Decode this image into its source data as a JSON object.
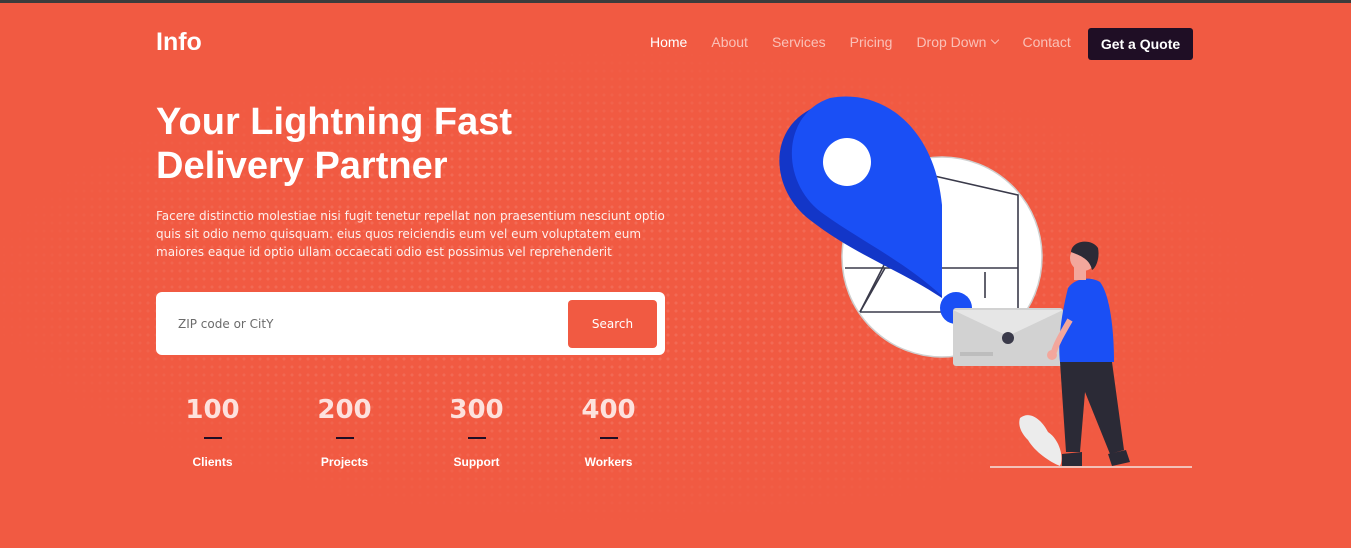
{
  "header": {
    "logo": "Info",
    "nav": [
      {
        "label": "Home",
        "active": true
      },
      {
        "label": "About",
        "active": false
      },
      {
        "label": "Services",
        "active": false
      },
      {
        "label": "Pricing",
        "active": false
      },
      {
        "label": "Drop Down",
        "active": false,
        "has_dropdown": true
      },
      {
        "label": "Contact",
        "active": false
      }
    ],
    "cta_label": "Get a Quote"
  },
  "hero": {
    "title_line1": "Your Lightning Fast",
    "title_line2": "Delivery Partner",
    "description": "Facere distinctio molestiae nisi fugit tenetur repellat non praesentium nesciunt optio quis sit odio nemo quisquam. eius quos reiciendis eum vel eum voluptatem eum maiores eaque id optio ullam occaecati odio est possimus vel reprehenderit"
  },
  "search": {
    "placeholder": "ZIP code or CitY",
    "value": "",
    "button_label": "Search"
  },
  "stats": [
    {
      "value": "100",
      "label": "Clients"
    },
    {
      "value": "200",
      "label": "Projects"
    },
    {
      "value": "300",
      "label": "Support"
    },
    {
      "value": "400",
      "label": "Workers"
    }
  ],
  "colors": {
    "background": "#f15a42",
    "accent_dark": "#1f0e25",
    "pin_blue": "#1a4ff5",
    "white": "#ffffff"
  },
  "icons": {
    "dropdown": "chevron-down-icon",
    "illustration": "delivery-illustration"
  }
}
